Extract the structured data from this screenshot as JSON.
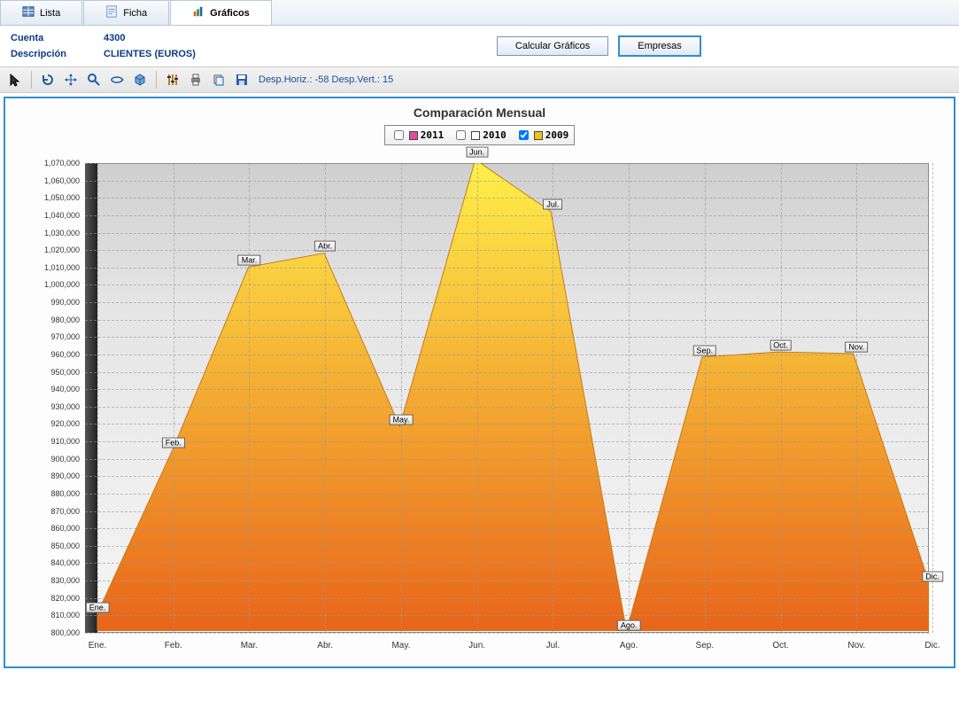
{
  "tabs": [
    {
      "label": "Lista",
      "icon": "table-icon"
    },
    {
      "label": "Ficha",
      "icon": "form-icon"
    },
    {
      "label": "Gráficos",
      "icon": "chart-icon"
    }
  ],
  "active_tab": 2,
  "account": {
    "label": "Cuenta",
    "value": "4300"
  },
  "description": {
    "label": "Descripción",
    "value": "CLIENTES (EUROS)"
  },
  "buttons": {
    "calc": "Calcular Gráficos",
    "emp": "Empresas"
  },
  "toolbar": {
    "desp_text": "Desp.Horiz.: -58 Desp.Vert.: 15"
  },
  "chart_data": {
    "type": "area",
    "title": "Comparación Mensual",
    "legend": [
      {
        "year": "2011",
        "checked": false,
        "color": "#e34b9d"
      },
      {
        "year": "2010",
        "checked": false,
        "color": "#ffffff"
      },
      {
        "year": "2009",
        "checked": true,
        "color": "#f3c21a"
      }
    ],
    "categories": [
      "Ene.",
      "Feb.",
      "Mar.",
      "Abr.",
      "May.",
      "Jun.",
      "Jul.",
      "Ago.",
      "Sep.",
      "Oct.",
      "Nov.",
      "Dic."
    ],
    "point_labels": [
      "Ene.",
      "Feb.",
      "Mar.",
      "Abr.",
      "May.",
      "Jun.",
      "Jul.",
      "Ago.",
      "Sep.",
      "Oct.",
      "Nov.",
      "Dic."
    ],
    "series": [
      {
        "name": "2009",
        "color_top": "#fff04a",
        "color_bottom": "#e8651a",
        "values": [
          810000,
          905000,
          1010000,
          1018000,
          918000,
          1072000,
          1042000,
          800000,
          958000,
          961000,
          960000,
          828000
        ]
      }
    ],
    "ylim": [
      800000,
      1070000
    ],
    "yticks": [
      800000,
      810000,
      820000,
      830000,
      840000,
      850000,
      860000,
      870000,
      880000,
      890000,
      900000,
      910000,
      920000,
      930000,
      940000,
      950000,
      960000,
      970000,
      980000,
      990000,
      1000000,
      1010000,
      1020000,
      1030000,
      1040000,
      1050000,
      1060000,
      1070000
    ],
    "baseline": 800000
  }
}
